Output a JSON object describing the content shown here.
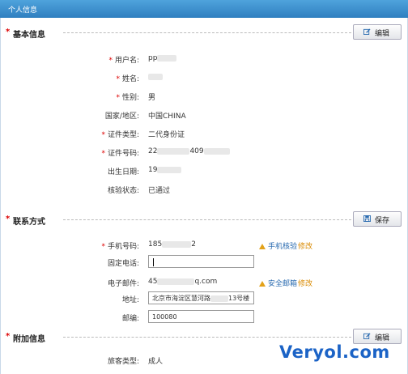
{
  "window": {
    "title": "个人信息"
  },
  "sections": {
    "basic": {
      "title": "基本信息",
      "button": "编辑"
    },
    "contact": {
      "title": "联系方式",
      "button": "保存"
    },
    "extra": {
      "title": "附加信息",
      "button": "编辑"
    }
  },
  "basic_rows": [
    {
      "label": "用户名:",
      "required": true,
      "value": "pp"
    },
    {
      "label": "姓名:",
      "required": true,
      "value": ""
    },
    {
      "label": "性别:",
      "required": true,
      "value": "男"
    },
    {
      "label": "国家/地区:",
      "required": false,
      "value": "中国CHINA"
    },
    {
      "label": "证件类型:",
      "required": true,
      "value": "二代身份证"
    },
    {
      "label": "证件号码:",
      "required": true,
      "value_a": "22",
      "value_b": "409"
    },
    {
      "label": "出生日期:",
      "required": false,
      "value": "19"
    },
    {
      "label": "核验状态:",
      "required": false,
      "value": "已通过"
    }
  ],
  "contact": {
    "phone_label": "手机号码:",
    "phone_a": "185",
    "phone_b": "2",
    "phone_verify": "手机核验",
    "phone_edit": "修改",
    "tel_label": "固定电话:",
    "tel_value": "",
    "email_label": "电子邮件:",
    "email_a": "45",
    "email_b": "q.com",
    "email_secure": "安全邮箱",
    "email_edit": "修改",
    "addr_label": "地址:",
    "addr_a": "北京市海淀区慧河路",
    "addr_b": "13号楼",
    "zip_label": "邮编:",
    "zip_value": "100080"
  },
  "extra": {
    "type_label": "旅客类型:",
    "type_value": "成人"
  },
  "watermark": "Veryol.com",
  "colors": {
    "header": "#2f7fc0",
    "required": "#dd0000",
    "link": "#2a6bb0",
    "watermark": "#1b63c6"
  }
}
